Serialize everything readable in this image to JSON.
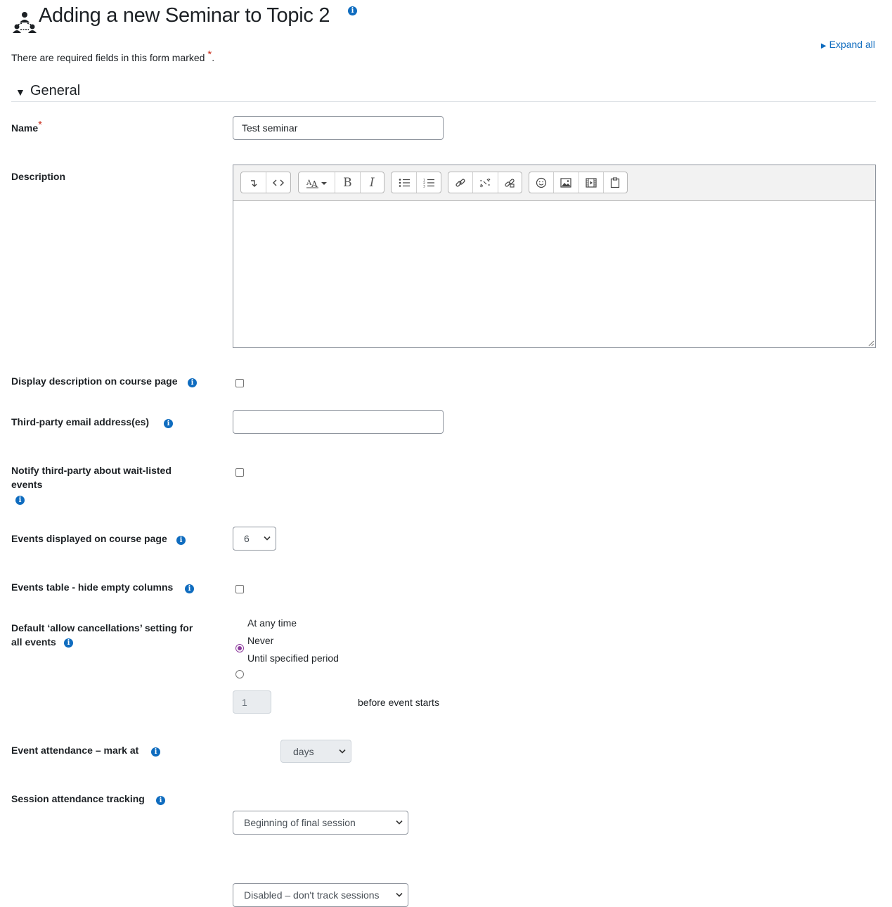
{
  "page": {
    "title": "Adding a new Seminar to Topic 2",
    "required_note": "There are required fields in this form marked",
    "required_note_end": ".",
    "expand_all": "Expand all",
    "info_glyph": "i",
    "required_marker": "*"
  },
  "section": {
    "general_label": "General"
  },
  "fields": {
    "name": {
      "label": "Name",
      "value": "Test seminar"
    },
    "description": {
      "label": "Description"
    },
    "display_description": {
      "label": "Display description on course page",
      "checked": false
    },
    "third_party_email": {
      "label": "Third-party email address(es)",
      "value": ""
    },
    "notify_third_party": {
      "label_line1": "Notify third-party about wait-listed",
      "label_line2": "events",
      "checked": false
    },
    "events_displayed": {
      "label": "Events displayed on course page",
      "value": "6"
    },
    "hide_empty_columns": {
      "label": "Events table - hide empty columns",
      "checked": false
    },
    "allow_cancellations": {
      "label_line1": "Default ‘allow cancellations’ setting for",
      "label_line2": "all events",
      "options": [
        "At any time",
        "Never",
        "Until specified period"
      ],
      "selected": "At any time",
      "period_value": "1",
      "period_unit": "days",
      "period_suffix": "before event starts"
    },
    "attendance_mark_at": {
      "label": "Event attendance – mark at",
      "value": "Beginning of final session"
    },
    "session_tracking": {
      "label": "Session attendance tracking",
      "value": "Disabled – don't track sessions"
    }
  },
  "editor_toolbar": {
    "groups": [
      [
        "insert-line-icon",
        "html-source-icon"
      ],
      [
        "font-style-icon",
        "bold-icon",
        "italic-icon"
      ],
      [
        "bullet-list-icon",
        "numbered-list-icon"
      ],
      [
        "link-icon",
        "unlink-icon",
        "manage-files-icon"
      ],
      [
        "emoticon-icon",
        "image-icon",
        "media-icon",
        "paste-icon"
      ]
    ]
  },
  "colors": {
    "link": "#0f6cbf",
    "required": "#ca3120",
    "radio_accent": "#8e3d9e",
    "text": "#1d2125"
  }
}
